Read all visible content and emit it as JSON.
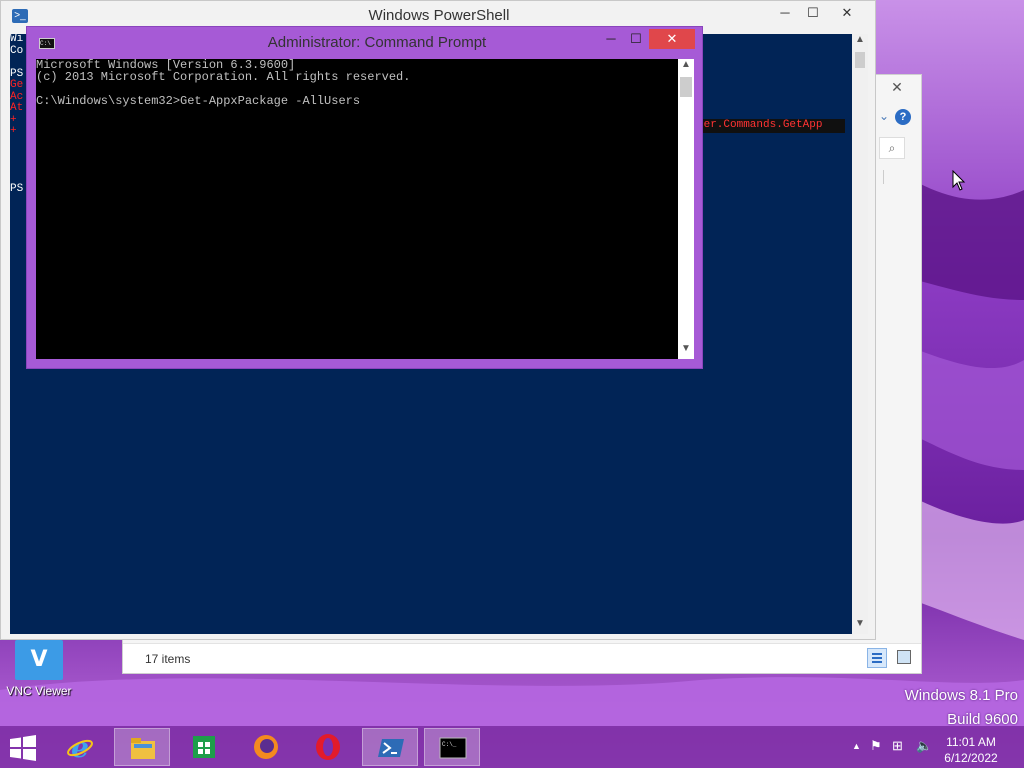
{
  "desktop": {
    "icon_label": "VNC Viewer",
    "watermark_line1": "Windows 8.1 Pro",
    "watermark_line2": "Build 9600"
  },
  "explorer": {
    "items_count": "17 items"
  },
  "powershell": {
    "title": "Windows PowerShell",
    "console_lines": [
      {
        "text": "Wi",
        "type": "normal"
      },
      {
        "text": "Co",
        "type": "normal"
      },
      {
        "text": "",
        "type": "normal"
      },
      {
        "text": "PS",
        "type": "normal"
      },
      {
        "text": "Ge",
        "type": "err"
      },
      {
        "text": "Ac",
        "type": "err"
      },
      {
        "text": "At",
        "type": "err"
      },
      {
        "text": "+ ",
        "type": "err"
      },
      {
        "text": "+ ",
        "type": "err"
      },
      {
        "text": "",
        "type": "normal"
      },
      {
        "text": "",
        "type": "normal"
      },
      {
        "text": "",
        "type": "normal"
      },
      {
        "text": "",
        "type": "normal"
      },
      {
        "text": "PS",
        "type": "normal"
      }
    ],
    "error_tail": "ger.Commands.GetApp"
  },
  "cmd": {
    "title": "Administrator: Command Prompt",
    "lines": [
      "Microsoft Windows [Version 6.3.9600]",
      "(c) 2013 Microsoft Corporation. All rights reserved.",
      "",
      "C:\\Windows\\system32>Get-AppxPackage -AllUsers"
    ]
  },
  "taskbar": {
    "apps": [
      {
        "name": "internet-explorer",
        "active": false
      },
      {
        "name": "file-explorer",
        "active": true
      },
      {
        "name": "store",
        "active": false
      },
      {
        "name": "firefox",
        "active": false
      },
      {
        "name": "opera",
        "active": false
      },
      {
        "name": "powershell",
        "active": true
      },
      {
        "name": "command-prompt",
        "active": true
      }
    ]
  },
  "clock": {
    "time": "11:01 AM",
    "date": "6/12/2022"
  }
}
